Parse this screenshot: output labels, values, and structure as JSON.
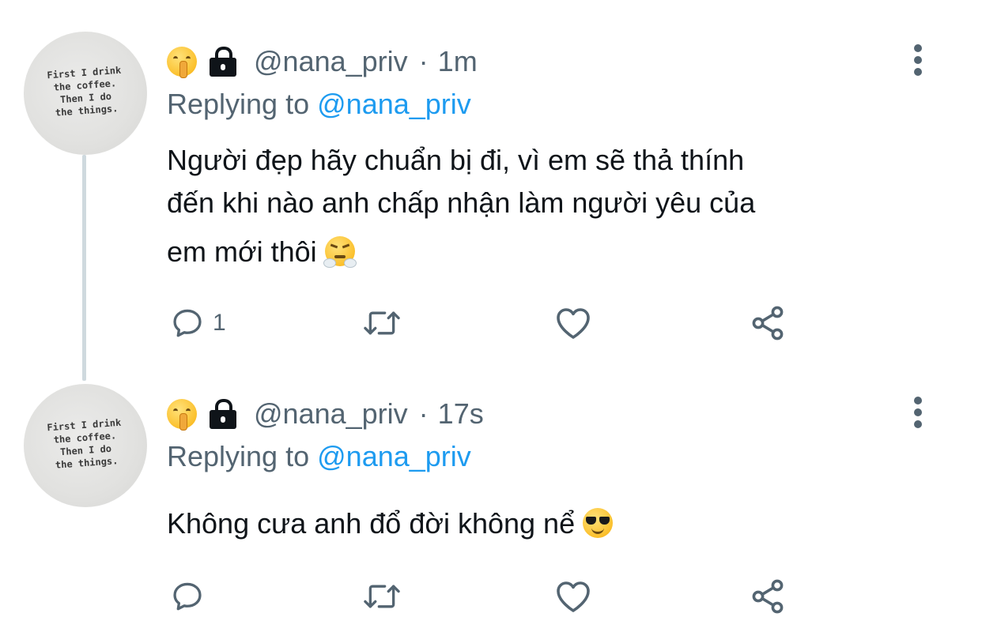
{
  "tweets": [
    {
      "avatar_text": "First I drink\nthe coffee.\nThen I do\nthe things.",
      "handle": "@nana_priv",
      "separator": "·",
      "time": "1m",
      "replying_label": "Replying to",
      "replying_handle": "@nana_priv",
      "text_line1": "Người đẹp hãy chuẩn bị đi, vì em sẽ thả thính",
      "text_line2": "đến khi nào anh chấp nhận làm người yêu của",
      "text_line3": "em mới thôi",
      "emoji": "face-with-steam-from-nose-icon",
      "reply_count": "1"
    },
    {
      "avatar_text": "First I drink\nthe coffee.\nThen I do\nthe things.",
      "handle": "@nana_priv",
      "separator": "·",
      "time": "17s",
      "replying_label": "Replying to",
      "replying_handle": "@nana_priv",
      "text_line1": "Không cưa anh đổ đời không nể",
      "emoji": "smiling-face-with-sunglasses-icon",
      "reply_count": ""
    }
  ],
  "colors": {
    "text_primary": "#0f1419",
    "text_secondary": "#536471",
    "link": "#1d9bf0",
    "thread_line": "#cfd9de"
  },
  "icons": {
    "name_emoji": "shushing-face-icon",
    "protected": "lock-icon",
    "more": "more-vertical-icon",
    "reply": "reply-icon",
    "retweet": "retweet-icon",
    "like": "heart-icon",
    "share": "share-icon"
  }
}
